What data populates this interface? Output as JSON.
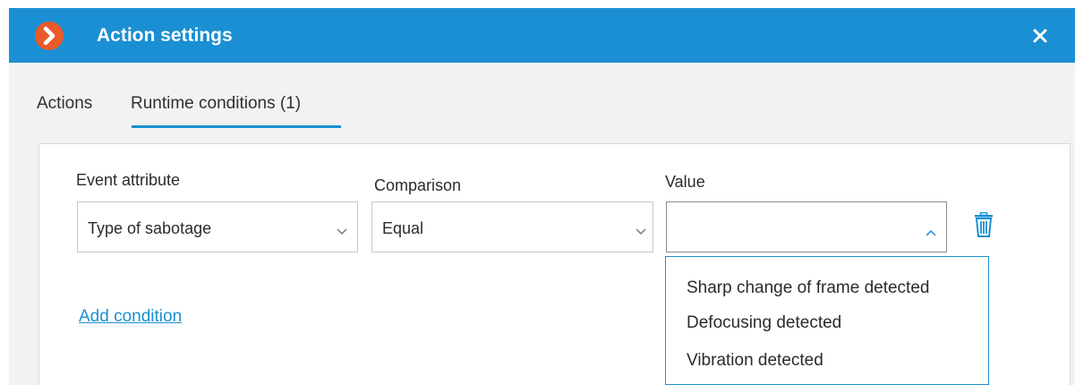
{
  "dialog": {
    "title": "Action settings",
    "close_symbol": "×",
    "logo_icon": "app-logo-chevron-icon",
    "colors": {
      "titlebar": "#1b8fd3",
      "logo": "#ea5a2a",
      "accent": "#1b8fd3",
      "link": "#1b8fd3",
      "dialog_background": "#f2f2f2"
    }
  },
  "tabs": [
    {
      "label": "Actions",
      "active": false
    },
    {
      "label": "Runtime conditions (1)",
      "active": true
    }
  ],
  "condition": {
    "event_attribute": {
      "label": "Event attribute",
      "value": "Type of sabotage",
      "icon": "chevron-down-icon"
    },
    "comparison": {
      "label": "Comparison",
      "value": "Equal",
      "icon": "chevron-down-icon"
    },
    "value": {
      "label": "Value",
      "selected": "",
      "expanded": true,
      "icon": "chevron-up-icon",
      "options": [
        "Sharp change of frame detected",
        "Defocusing detected",
        "Vibration detected"
      ]
    },
    "delete_icon": "trash-icon"
  },
  "add_condition_label": "Add condition"
}
